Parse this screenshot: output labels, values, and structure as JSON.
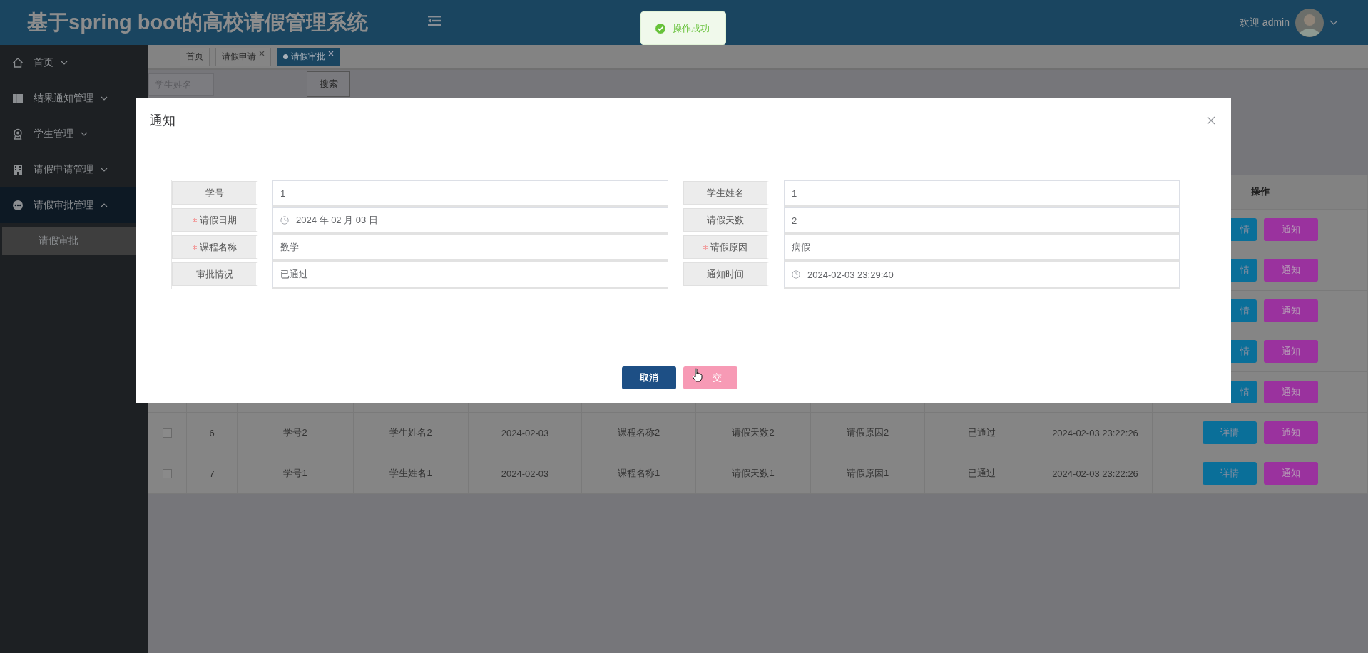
{
  "header": {
    "title": "基于spring boot的高校请假管理系统",
    "welcome": "欢迎 admin"
  },
  "toast": {
    "kind": "success",
    "message": "操作成功"
  },
  "sidebar": {
    "items": [
      {
        "label": "首页",
        "expanded": false
      },
      {
        "label": "结果通知管理",
        "expanded": false
      },
      {
        "label": "学生管理",
        "expanded": false
      },
      {
        "label": "请假申请管理",
        "expanded": false
      },
      {
        "label": "请假审批管理",
        "expanded": true,
        "children": [
          {
            "label": "请假审批",
            "selected": true
          }
        ]
      }
    ]
  },
  "tabs": [
    {
      "label": "首页",
      "closable": false,
      "selected": false
    },
    {
      "label": "请假申请",
      "closable": true,
      "selected": false
    },
    {
      "label": "请假审批",
      "closable": true,
      "selected": true
    }
  ],
  "search": {
    "placeholder": "学生姓名",
    "button": "搜索"
  },
  "table": {
    "action_column": "操作",
    "rows": [
      {
        "actions": [
          "情",
          "通知"
        ]
      },
      {
        "actions": [
          "情",
          "通知"
        ]
      },
      {
        "actions": [
          "情",
          "通知"
        ]
      },
      {
        "actions": [
          "情",
          "通知"
        ]
      },
      {
        "actions": [
          "情",
          "通知"
        ]
      },
      {
        "checked": false,
        "cells": [
          "6",
          "学号2",
          "学生姓名2",
          "2024-02-03",
          "课程名称2",
          "请假天数2",
          "请假原因2",
          "已通过",
          "2024-02-03 23:22:26"
        ],
        "actions": [
          "详情",
          "通知"
        ]
      },
      {
        "checked": false,
        "cells": [
          "7",
          "学号1",
          "学生姓名1",
          "2024-02-03",
          "课程名称1",
          "请假天数1",
          "请假原因1",
          "已通过",
          "2024-02-03 23:22:26"
        ],
        "actions": [
          "详情",
          "通知"
        ]
      }
    ]
  },
  "modal": {
    "title": "通知",
    "fields": [
      {
        "label": "学号",
        "required": false,
        "kind": "text",
        "value": "1"
      },
      {
        "label": "学生姓名",
        "required": false,
        "kind": "text",
        "value": "1"
      },
      {
        "label": "请假日期",
        "required": true,
        "kind": "date",
        "value": "2024 年 02 月 03 日"
      },
      {
        "label": "请假天数",
        "required": false,
        "kind": "text",
        "value": "2"
      },
      {
        "label": "课程名称",
        "required": true,
        "kind": "text",
        "value": "数学"
      },
      {
        "label": "请假原因",
        "required": true,
        "kind": "text",
        "value": "病假"
      },
      {
        "label": "审批情况",
        "required": false,
        "kind": "text",
        "value": "已通过"
      },
      {
        "label": "通知时间",
        "required": false,
        "kind": "date",
        "value": "2024-02-03 23:29:40"
      }
    ],
    "buttons": [
      {
        "label": "取消",
        "kind": "cancel"
      },
      {
        "label": "交",
        "kind": "submit"
      }
    ]
  }
}
